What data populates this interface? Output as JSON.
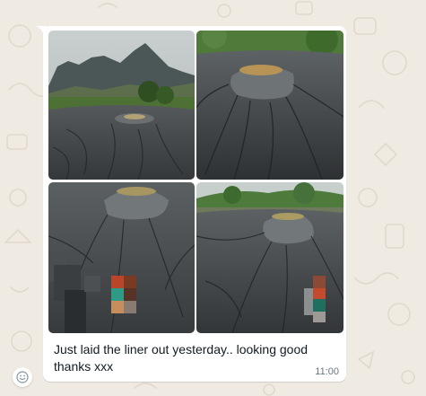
{
  "message": {
    "caption": "Just laid the liner out yesterday.. looking good thanks xxx",
    "time": "11:00",
    "photo_count": 4
  },
  "colors": {
    "chat_background": "#efeae2",
    "bubble": "#ffffff",
    "caption_text": "#111b21",
    "timestamp_text": "#667781"
  },
  "icons": [
    "media-photo",
    "reaction-smiley-icon"
  ]
}
